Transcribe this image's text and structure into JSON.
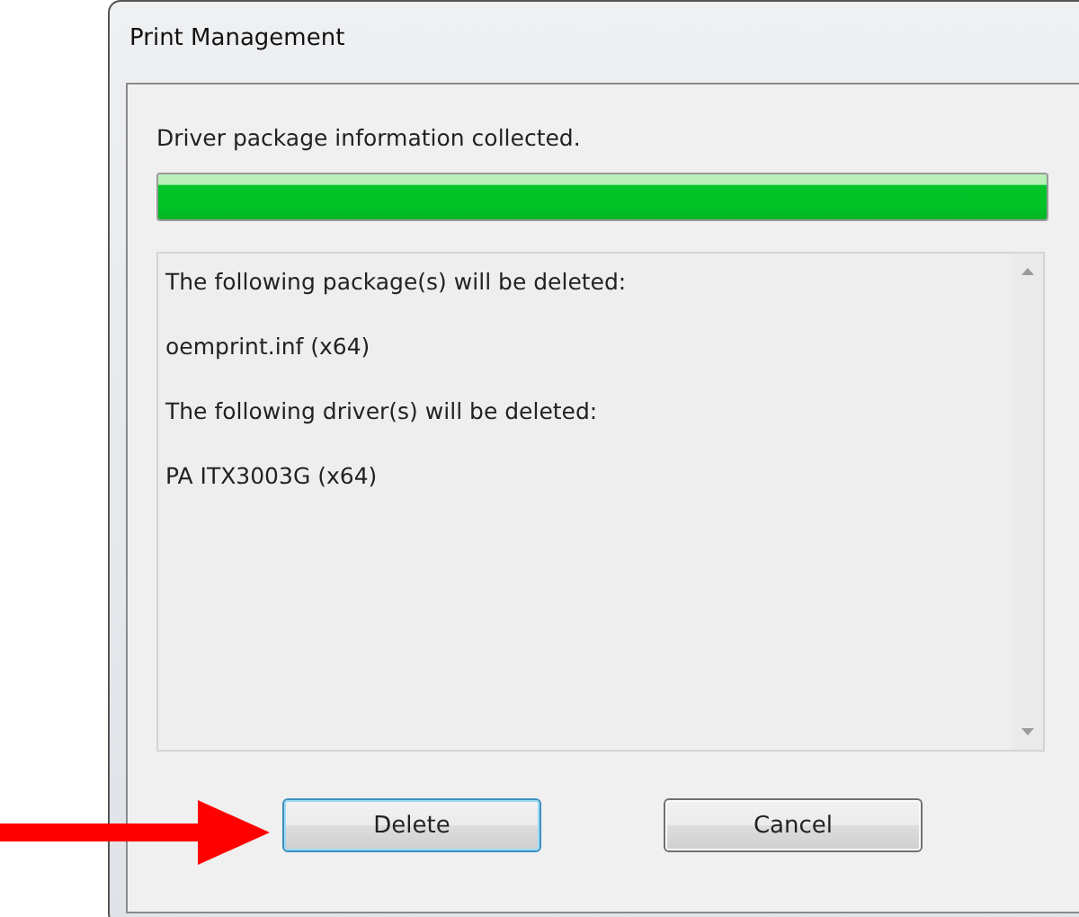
{
  "window": {
    "title": "Print Management"
  },
  "status": "Driver package information collected.",
  "progress": {
    "level": 1
  },
  "details": {
    "lines": [
      "The following package(s) will be deleted:",
      "oemprint.inf (x64)",
      "The following driver(s) will be deleted:",
      "PA ITX3003G (x64)"
    ]
  },
  "buttons": [
    {
      "label": "Delete",
      "focused": true
    },
    {
      "label": "Cancel",
      "focused": false
    }
  ]
}
